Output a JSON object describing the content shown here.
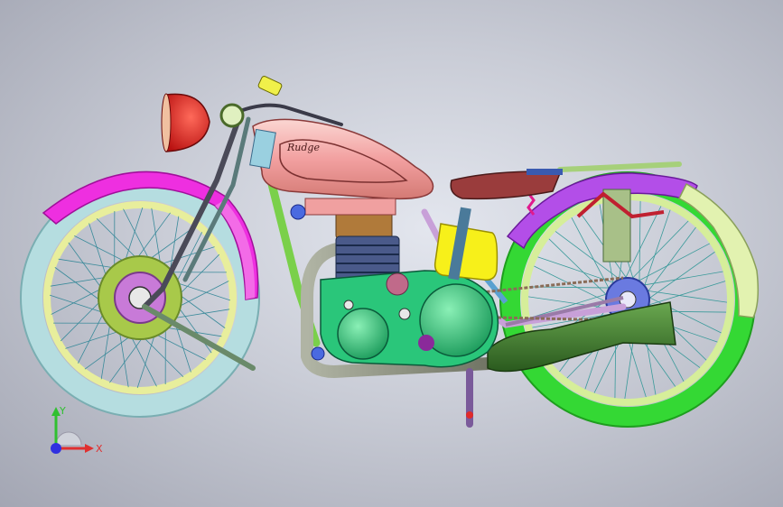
{
  "viewport": {
    "background_inner": "#e3e6ee",
    "background_outer": "#a3a6b3"
  },
  "model": {
    "tank_badge": "Rudge",
    "colors": {
      "front_tire": "#b5dde0",
      "front_rim": "#e8ee9c",
      "front_fender": "#ee2fe0",
      "front_hub": "#a8c94a",
      "rear_tire": "#34d834",
      "rear_rim": "#d6ee9a",
      "rear_fender_front": "#b34ee8",
      "rear_fender_back": "#e2f2b0",
      "fuel_tank": "#f2a0a0",
      "headlight": "#e32020",
      "engine_case": "#2ac67a",
      "cylinder": "#4a5a8a",
      "oil_tank": "#f7f01a",
      "exhaust": "#8a8e7c",
      "muffler": "#3e7a2c",
      "seat": "#9a3c3c",
      "spring": "#e01a8e",
      "frame": "#7ad04a",
      "chain": "#8a6c58",
      "rear_shock": "#a8c088",
      "stand": "#7a5a9a"
    }
  },
  "triad": {
    "x_label": "X",
    "y_label": "Y",
    "x_color": "#e03030",
    "y_color": "#30c030",
    "z_color": "#3030e0"
  }
}
